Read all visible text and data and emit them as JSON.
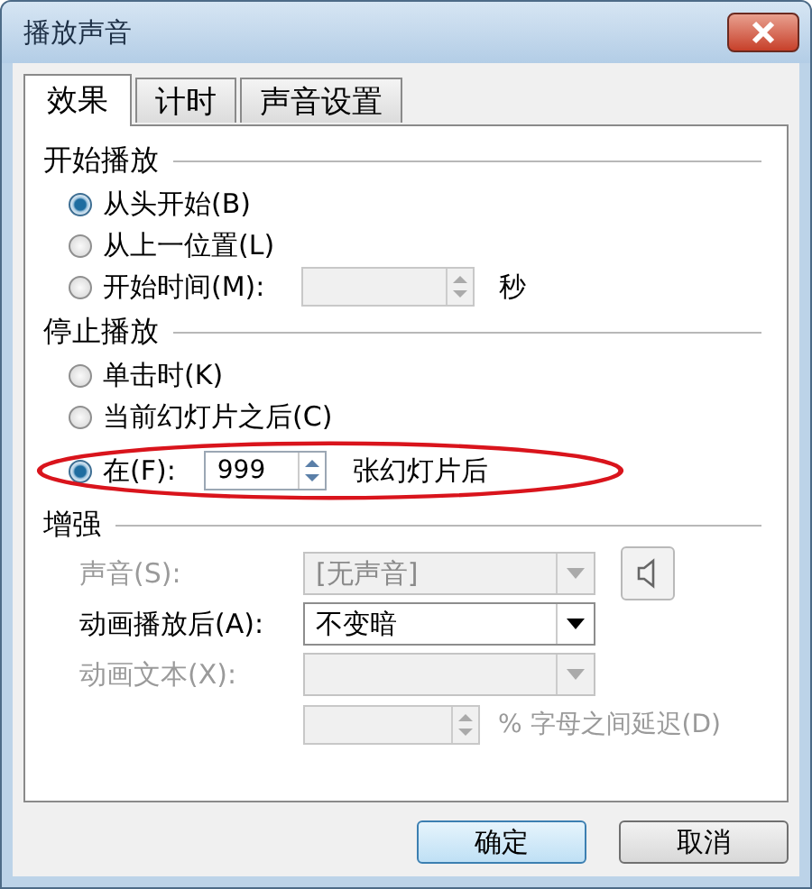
{
  "window": {
    "title": "播放声音"
  },
  "tabs": [
    {
      "label": "效果",
      "selected": true
    },
    {
      "label": "计时",
      "selected": false
    },
    {
      "label": "声音设置",
      "selected": false
    }
  ],
  "start_playback": {
    "heading": "开始播放",
    "options": [
      {
        "label": "从头开始(B)",
        "selected": true
      },
      {
        "label": "从上一位置(L)",
        "selected": false
      },
      {
        "label": "开始时间(M):",
        "selected": false,
        "field": {
          "disabled": true
        },
        "unit": "秒"
      }
    ]
  },
  "stop_playback": {
    "heading": "停止播放",
    "options": [
      {
        "label": "单击时(K)",
        "selected": false
      },
      {
        "label": "当前幻灯片之后(C)",
        "selected": false
      },
      {
        "label": "在(F):",
        "selected": true,
        "field": {
          "value": "999",
          "disabled": false
        },
        "unit": "张幻灯片后",
        "highlighted": true
      }
    ]
  },
  "enhancements": {
    "heading": "增强",
    "rows": [
      {
        "kind": "select",
        "label": "声音(S):",
        "value": "[无声音]",
        "disabled": true,
        "speaker_button": true
      },
      {
        "kind": "select",
        "label": "动画播放后(A):",
        "value": "不变暗",
        "disabled": false
      },
      {
        "kind": "select",
        "label": "动画文本(X):",
        "disabled": true
      },
      {
        "kind": "spinner",
        "disabled": true,
        "unit": "% 字母之间延迟(D)"
      }
    ]
  },
  "buttons": [
    {
      "label": "确定",
      "default": true
    },
    {
      "label": "取消",
      "default": false
    }
  ]
}
